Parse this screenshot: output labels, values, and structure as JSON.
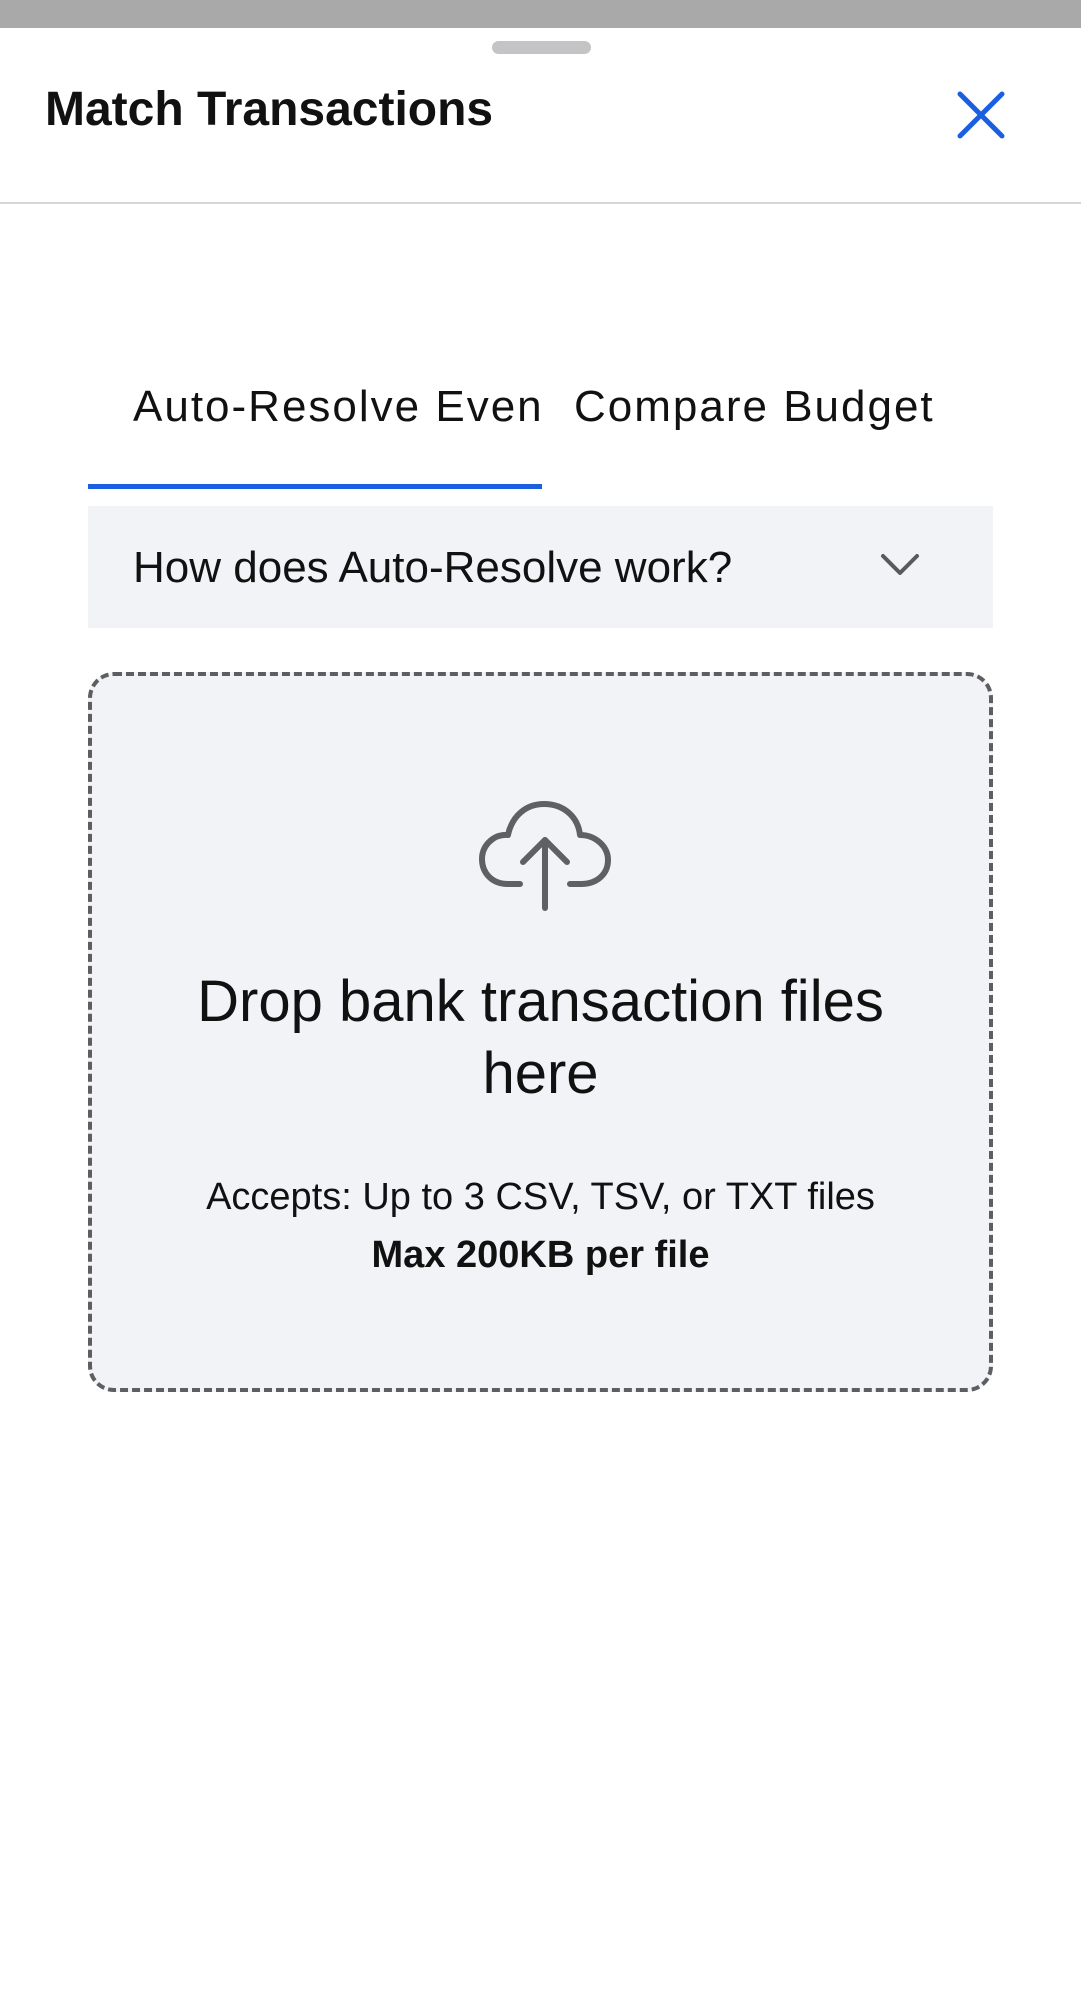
{
  "sheet": {
    "title": "Match Transactions",
    "close_icon": "close-icon",
    "accent_color": "#1a5fe0"
  },
  "tabs": [
    {
      "label": "Auto-Resolve Even",
      "selected": true
    },
    {
      "label": "Compare Budget",
      "selected": false
    }
  ],
  "accordion": {
    "label": "How does Auto-Resolve work?",
    "icon": "chevron-down-icon",
    "expanded": false
  },
  "dropzone": {
    "icon": "cloud-upload-icon",
    "title": "Drop bank transaction files here",
    "accepts": "Accepts: Up to 3 CSV, TSV, or TXT files",
    "max_size": "Max 200KB per file"
  }
}
